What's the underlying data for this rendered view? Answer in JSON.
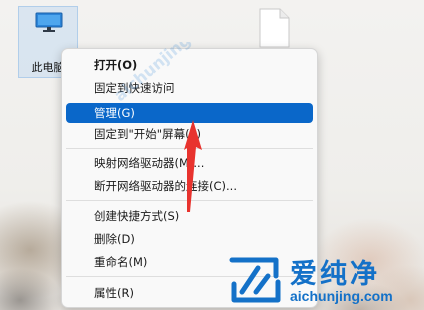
{
  "desktop": {
    "icons": [
      {
        "label": "此电脑",
        "icon": "monitor-icon"
      },
      {
        "label": "",
        "icon": "file-icon"
      }
    ]
  },
  "context_menu": {
    "items": [
      {
        "label": "打开(O)",
        "bold": true
      },
      {
        "label": "固定到快速访问"
      },
      {
        "label": "管理(G)",
        "selected": true
      },
      {
        "label": "固定到\"开始\"屏幕(P)"
      },
      {
        "label": "映射网络驱动器(M)..."
      },
      {
        "label": "断开网络驱动器的连接(C)..."
      },
      {
        "label": "创建快捷方式(S)"
      },
      {
        "label": "删除(D)"
      },
      {
        "label": "重命名(M)"
      },
      {
        "label": "属性(R)"
      }
    ]
  },
  "annotation": {
    "arrow_color": "#e8332e",
    "arrow_target": "管理(G)"
  },
  "watermark": {
    "title": "爱纯净",
    "url": "aichunjing.com",
    "diagonal_text": "aichunjing",
    "color": "#1471c8"
  },
  "colors": {
    "selection": "#0a67c9",
    "menu_background": "#f9f9f9"
  }
}
